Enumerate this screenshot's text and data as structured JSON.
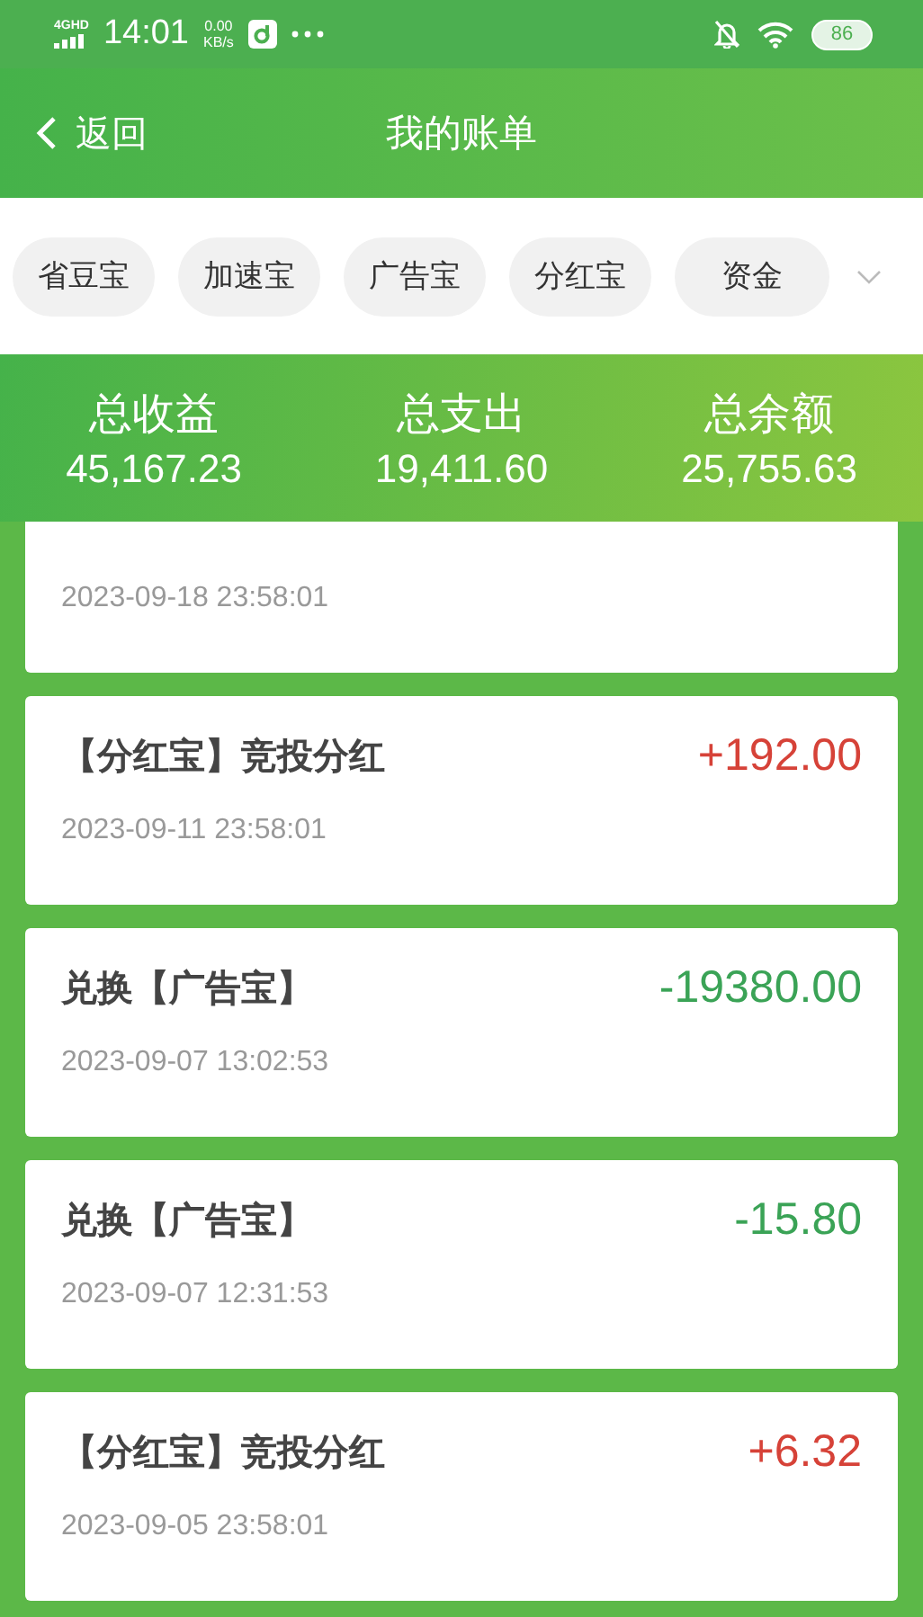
{
  "status_bar": {
    "network": "4GHD",
    "time": "14:01",
    "speed": "0.00",
    "speed_unit": "KB/s",
    "battery": "86"
  },
  "header": {
    "back": "返回",
    "title": "我的账单"
  },
  "categories": [
    {
      "label": "省豆宝",
      "selected": false
    },
    {
      "label": "加速宝",
      "selected": false
    },
    {
      "label": "广告宝",
      "selected": false
    },
    {
      "label": "分红宝",
      "selected": false
    },
    {
      "label": "资金",
      "selected": false
    }
  ],
  "summary": [
    {
      "label": "总收益",
      "value": "45,167.23"
    },
    {
      "label": "总支出",
      "value": "19,411.60"
    },
    {
      "label": "总余额",
      "value": "25,755.63"
    }
  ],
  "records": [
    {
      "time": "2023-09-18 23:58:01"
    },
    {
      "title": "【分红宝】竞投分红",
      "amount": "+192.00",
      "kind": "income",
      "time": "2023-09-11 23:58:01"
    },
    {
      "title": "兑换【广告宝】",
      "amount": "-19380.00",
      "kind": "expense",
      "time": "2023-09-07 13:02:53"
    },
    {
      "title": "兑换【广告宝】",
      "amount": "-15.80",
      "kind": "expense",
      "time": "2023-09-07 12:31:53"
    },
    {
      "title": "【分红宝】竞投分红",
      "amount": "+6.32",
      "kind": "income",
      "time": "2023-09-05 23:58:01"
    }
  ]
}
